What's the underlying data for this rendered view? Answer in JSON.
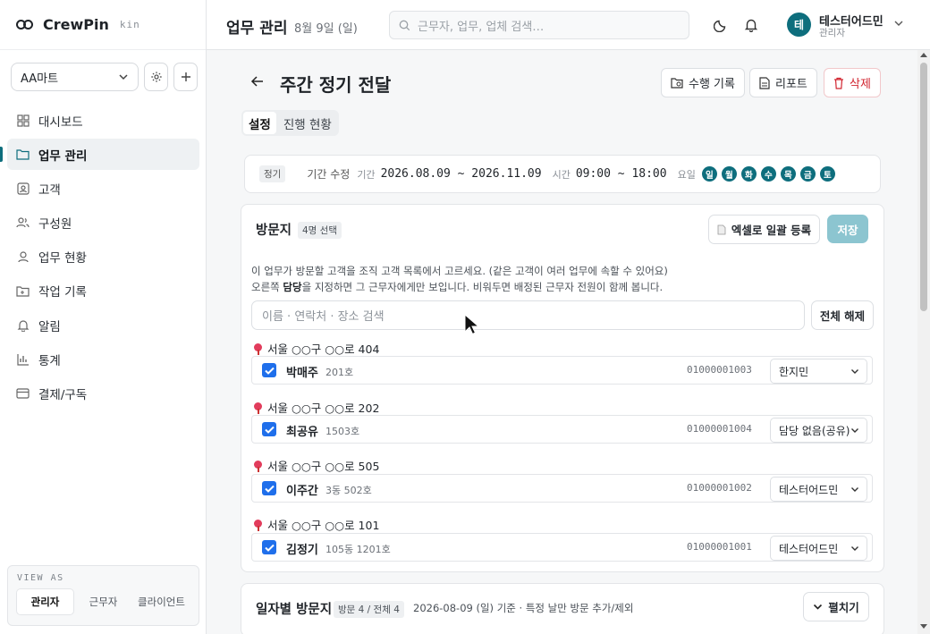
{
  "brand": {
    "name": "CrewPin",
    "sub": "kin"
  },
  "sidebar": {
    "store": "AA마트",
    "items": [
      {
        "label": "대시보드",
        "icon": "grid-icon"
      },
      {
        "label": "업무 관리",
        "icon": "folder-icon"
      },
      {
        "label": "고객",
        "icon": "contact-icon"
      },
      {
        "label": "구성원",
        "icon": "users-icon"
      },
      {
        "label": "업무 현황",
        "icon": "status-icon"
      },
      {
        "label": "작업 기록",
        "icon": "record-icon"
      },
      {
        "label": "알림",
        "icon": "bell-icon"
      },
      {
        "label": "통계",
        "icon": "chart-icon"
      },
      {
        "label": "결제/구독",
        "icon": "card-icon"
      }
    ],
    "view_as": {
      "title": "VIEW AS",
      "tabs": [
        "관리자",
        "근무자",
        "클라이언트"
      ]
    }
  },
  "topbar": {
    "title": "업무 관리",
    "date": "8월 9일 (일)",
    "search_placeholder": "근무자, 업무, 업체 검색…",
    "avatar_initial": "테",
    "user_name": "테스터어드민",
    "user_role": "관리자"
  },
  "page": {
    "title": "주간 정기 전달",
    "actions": {
      "history": "수행 기록",
      "report": "리포트",
      "delete": "삭제"
    },
    "tabs": [
      "설정",
      "진행 현황"
    ]
  },
  "schedule": {
    "type": "정기",
    "edit_period": "기간 수정",
    "period_label": "기간",
    "period": "2026.08.09 ~ 2026.11.09",
    "time_label": "시간",
    "time": "09:00 ~ 18:00",
    "days_label": "요일",
    "days": [
      "일",
      "월",
      "화",
      "수",
      "목",
      "금",
      "토"
    ]
  },
  "visit": {
    "title": "방문지",
    "count": "4명 선택",
    "excel_button": "엑셀로 일괄 등록",
    "save_button": "저장",
    "desc1": "이 업무가 방문할 고객을 조직 고객 목록에서 고르세요. (같은 고객이 여러 업무에 속할 수 있어요)",
    "desc2_pre": "오른쪽 ",
    "desc2_bold": "담당",
    "desc2_post": "을 지정하면 그 근무자에게만 보입니다. 비워두면 배정된 근무자 전원이 함께 봅니다.",
    "search_placeholder": "이름 · 연락처 · 장소 검색",
    "clear_button": "전체 해제",
    "groups": [
      {
        "address": "서울 ○○구 ○○로 404",
        "name": "박매주",
        "unit": "201호",
        "phone": "01000001003",
        "assignee": "한지민"
      },
      {
        "address": "서울 ○○구 ○○로 202",
        "name": "최공유",
        "unit": "1503호",
        "phone": "01000001004",
        "assignee": "담당 없음(공유)"
      },
      {
        "address": "서울 ○○구 ○○로 505",
        "name": "이주간",
        "unit": "3동 502호",
        "phone": "01000001002",
        "assignee": "테스터어드민"
      },
      {
        "address": "서울 ○○구 ○○로 101",
        "name": "김정기",
        "unit": "105동 1201호",
        "phone": "01000001001",
        "assignee": "테스터어드민"
      }
    ]
  },
  "daily": {
    "title": "일자별 방문지",
    "count": "방문 4 / 전체 4",
    "note": "2026-08-09 (일) 기준 · 특정 날만 방문 추가/제외",
    "expand_button": "펼치기"
  },
  "colors": {
    "accent": "#0e6e7d",
    "checkbox": "#1f6feb",
    "danger": "#d1242f",
    "save_disabled": "#8cc5d0"
  }
}
